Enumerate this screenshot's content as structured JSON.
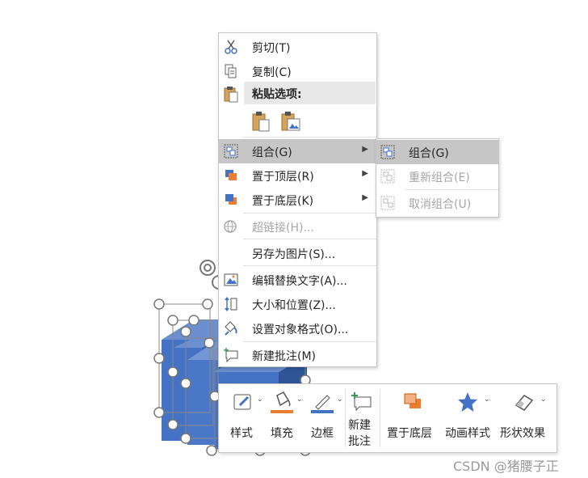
{
  "context_menu": {
    "cut": "剪切(T)",
    "copy": "复制(C)",
    "paste_options": "粘贴选项:",
    "group": "组合(G)",
    "bring_to_front": "置于顶层(R)",
    "send_to_back": "置于底层(K)",
    "hyperlink": "超链接(H)...",
    "save_as_picture": "另存为图片(S)...",
    "edit_alt_text": "编辑替换文字(A)...",
    "size_position": "大小和位置(Z)...",
    "format_object": "设置对象格式(O)...",
    "new_comment": "新建批注(M)"
  },
  "submenu": {
    "group": "组合(G)",
    "regroup": "重新组合(E)",
    "ungroup": "取消组合(U)"
  },
  "toolbar": {
    "style": "样式",
    "fill": "填充",
    "outline": "边框",
    "new_comment_line1": "新建",
    "new_comment_line2": "批注",
    "send_to_back": "置于底层",
    "animation_styles": "动画样式",
    "shape_effects": "形状效果"
  },
  "colors": {
    "fill_swatch": "#ed7d31",
    "outline_swatch": "#4472c4",
    "shape_blue": "#4472c4",
    "highlight": "#c6c6c6"
  },
  "watermark": "CSDN @猪腰子正"
}
